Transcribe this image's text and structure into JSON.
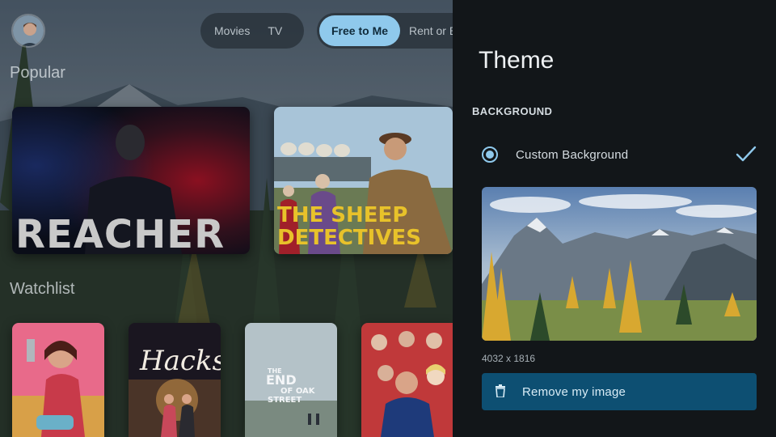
{
  "header": {
    "content_tabs": [
      {
        "label": "Movies",
        "active": false
      },
      {
        "label": "TV",
        "active": false
      }
    ],
    "filter_tabs": [
      {
        "label": "Free to Me",
        "active": true
      },
      {
        "label": "Rent or Buy",
        "active": false
      }
    ]
  },
  "sections": {
    "popular": {
      "title": "Popular",
      "items": [
        {
          "title": "REACHER"
        },
        {
          "title_line1": "THE SHEEP",
          "title_line2": "DETECTIVES"
        }
      ]
    },
    "watchlist": {
      "title": "Watchlist",
      "items": [
        {
          "title": ""
        },
        {
          "title": "Hacks"
        },
        {
          "title_line1": "THE",
          "title_line2": "END",
          "title_line3": "OF OAK",
          "title_line4": "STREET"
        },
        {
          "title": ""
        }
      ]
    }
  },
  "theme_panel": {
    "title": "Theme",
    "section_label": "BACKGROUND",
    "option": {
      "label": "Custom Background",
      "selected": true
    },
    "image_dimensions": "4032 x 1816",
    "remove_button_label": "Remove my image"
  },
  "colors": {
    "accent": "#8fc9ec",
    "panel_bg": "#121619",
    "button_bg": "#0d4f72"
  },
  "icons": [
    "avatar",
    "radio-selected-icon",
    "checkmark-icon",
    "trash-icon"
  ]
}
